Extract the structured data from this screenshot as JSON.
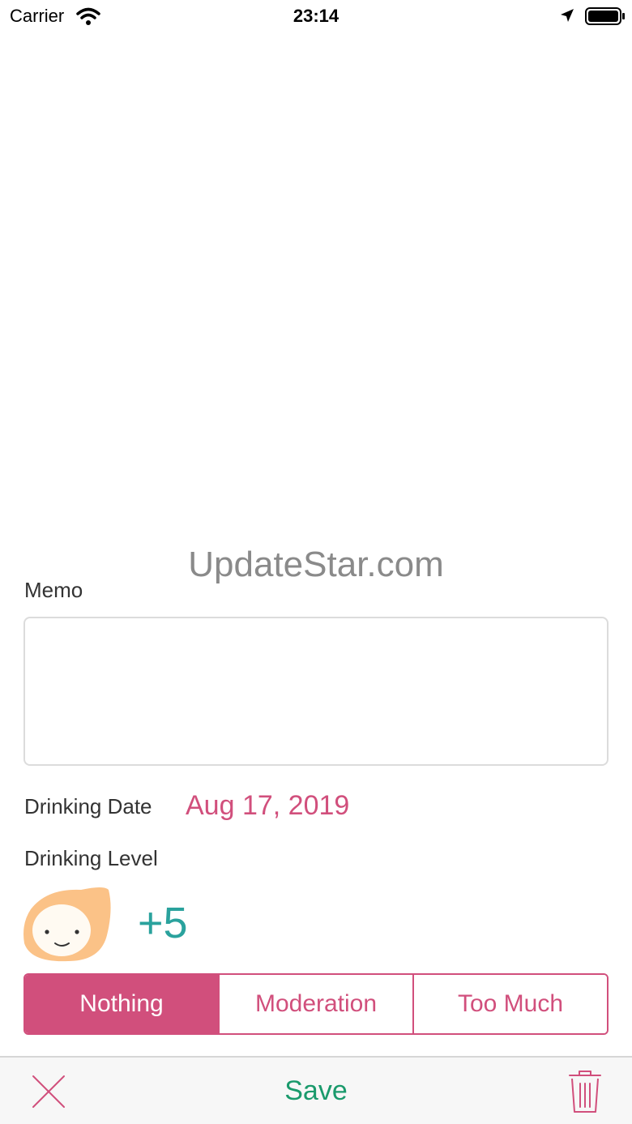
{
  "status_bar": {
    "carrier": "Carrier",
    "time": "23:14"
  },
  "watermark": "UpdateStar.com",
  "form": {
    "memo_label": "Memo",
    "memo_value": "",
    "drinking_date_label": "Drinking Date",
    "drinking_date_value": "Aug 17, 2019",
    "drinking_level_label": "Drinking Level",
    "score": "+5",
    "levels": [
      "Nothing",
      "Moderation",
      "Too Much"
    ],
    "selected_level": "Nothing"
  },
  "toolbar": {
    "save_label": "Save"
  },
  "colors": {
    "accent": "#d14f7c",
    "score": "#2aa29d",
    "save": "#1a9a6c",
    "mascot": "#fbc287"
  },
  "icons": [
    "wifi-icon",
    "location-arrow-icon",
    "battery-icon",
    "close-icon",
    "trash-icon"
  ]
}
